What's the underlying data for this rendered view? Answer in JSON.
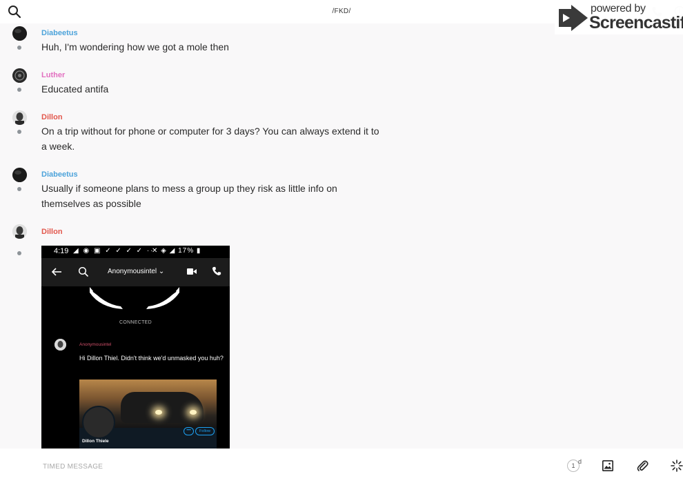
{
  "header": {
    "title": "/FKD/",
    "search_icon": "search-icon",
    "call_icon": "phone-icon",
    "info_icon": "info-icon"
  },
  "watermark": {
    "powered_by": "powered by",
    "brand": "Screencastify"
  },
  "messages": [
    {
      "sender": "Diabeetus",
      "sender_color": "#4da3da",
      "text": "Huh, I'm wondering how we got a mole then"
    },
    {
      "sender": "Luther",
      "sender_color": "#e26fc0",
      "text": "Educated antifa"
    },
    {
      "sender": "Dillon",
      "sender_color": "#e2574c",
      "text": "On a trip without for phone or computer for 3 days? You can always extend it to a week."
    },
    {
      "sender": "Diabeetus",
      "sender_color": "#4da3da",
      "text": "Usually if someone plans to mess a group up they risk as little info on themselves as possible"
    },
    {
      "sender": "Dillon",
      "sender_color": "#e2574c",
      "text": ""
    }
  ],
  "attachment": {
    "status_time": "4:19",
    "status_icons": "◢ ◉ ▣ ✓ ✓ ✓ ✓ ··",
    "status_right": "✕ ◈ ◢ 17% ▮",
    "chat_name": "Anonymousintel ⌄",
    "connected": "CONNECTED",
    "sender": "Anonymousintel",
    "text": "Hi Dillon Thiel. Didn't think we'd unmasked you huh?",
    "card_name": "Dillon Thiele",
    "card_more": "•••",
    "card_follow": "Follow"
  },
  "composer": {
    "placeholder": "TIMED MESSAGE",
    "timer_value": "1",
    "timer_unit": "d"
  }
}
